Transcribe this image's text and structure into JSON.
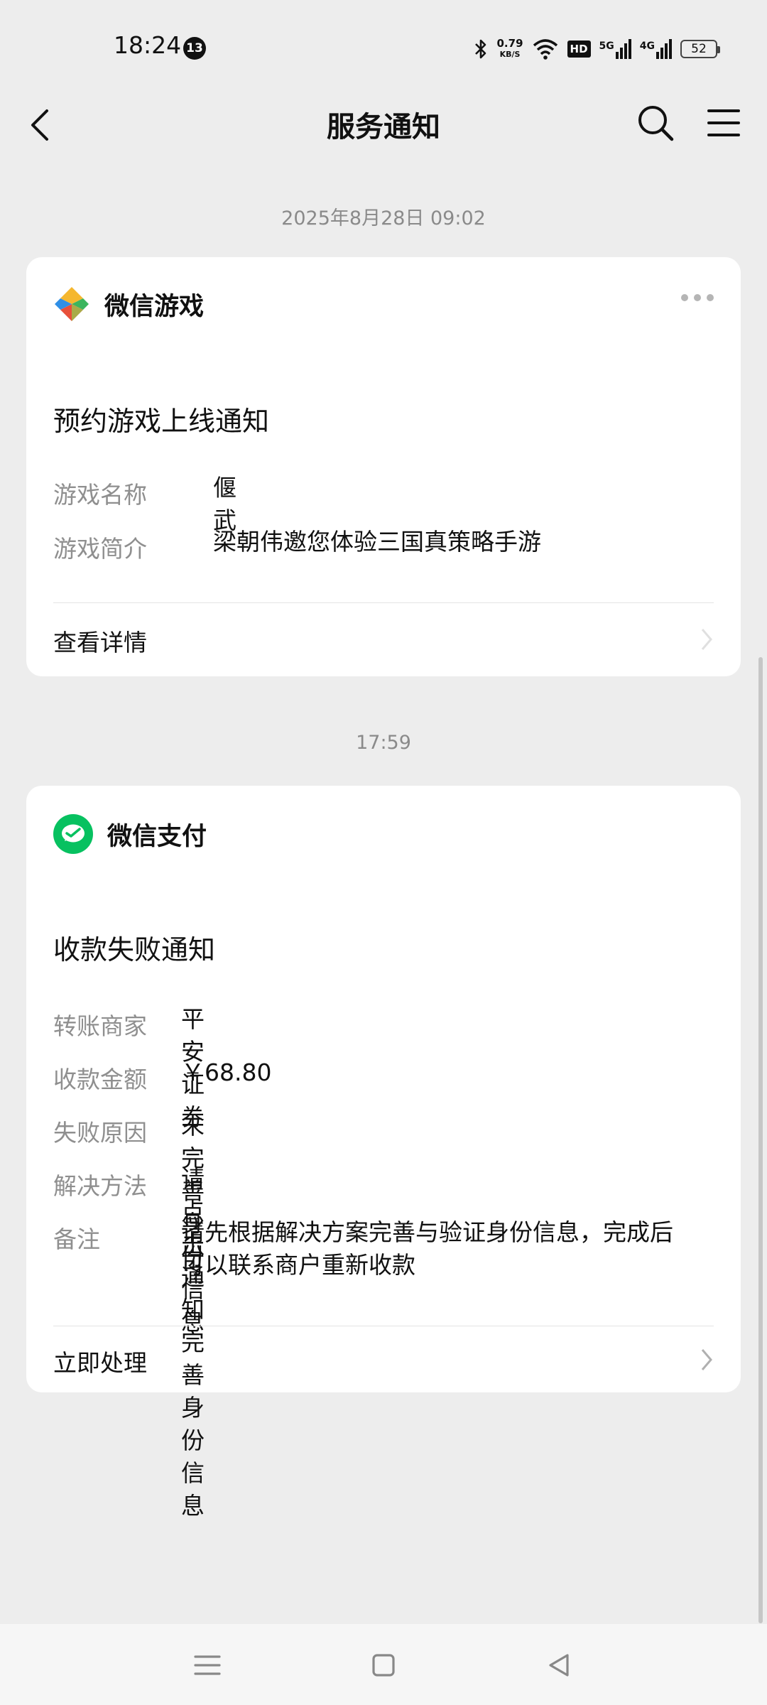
{
  "status_bar": {
    "time": "18:24",
    "notification_count": "13",
    "speed_value": "0.79",
    "speed_unit": "KB/S",
    "hd_label": "HD",
    "net1": "5G",
    "net2": "4G",
    "battery": "52"
  },
  "header": {
    "title": "服务通知"
  },
  "messages": [
    {
      "timestamp": "2025年8月28日 09:02",
      "brand": "微信游戏",
      "title": "预约游戏上线通知",
      "fields": [
        {
          "key": "游戏名称",
          "value": "偃武"
        },
        {
          "key": "游戏简介",
          "value": "梁朝伟邀您体验三国真策略手游"
        }
      ],
      "action": "查看详情"
    },
    {
      "timestamp": "17:59",
      "brand": "微信支付",
      "title": "收款失败通知",
      "fields": [
        {
          "key": "转账商家",
          "value": "平安证券"
        },
        {
          "key": "收款金额",
          "value": "￥68.80"
        },
        {
          "key": "失败原因",
          "value": "未完善身份信息"
        },
        {
          "key": "解决方法",
          "value": "请点击通知完善身份信息"
        },
        {
          "key": "备注",
          "value": "请先根据解决方案完善与验证身份信息，完成后\n可以联系商户重新收款"
        }
      ],
      "action": "立即处理"
    }
  ],
  "colors": {
    "background": "#ededed",
    "card": "#ffffff",
    "pay_green": "#07c160",
    "muted": "#8f8f8f"
  },
  "icons": [
    "back-arrow-icon",
    "search-icon",
    "menu-icon",
    "wechat-game-logo-icon",
    "wechat-pay-logo-icon",
    "more-dots-icon",
    "chevron-right-icon"
  ]
}
